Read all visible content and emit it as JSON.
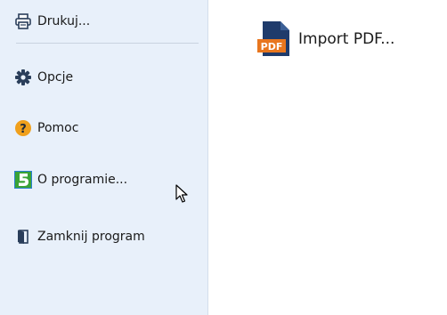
{
  "sidebar": {
    "items": [
      {
        "label": "Drukuj...",
        "icon": "printer-icon"
      },
      {
        "label": "Opcje",
        "icon": "gear-icon"
      },
      {
        "label": "Pomoc",
        "icon": "help-icon"
      },
      {
        "label": "O programie...",
        "icon": "app-logo-icon"
      },
      {
        "label": "Zamknij program",
        "icon": "exit-icon"
      }
    ]
  },
  "main": {
    "import_pdf": {
      "label": "Import PDF...",
      "icon": "pdf-icon"
    }
  },
  "colors": {
    "sidebar_bg": "#e8f0fa",
    "pdf_orange": "#e8761e",
    "pdf_navy": "#1f3b6b",
    "help_orange": "#f0a01c",
    "logo_green": "#3aa336",
    "logo_blue": "#2a7fd0",
    "icon_navy": "#2a3e5a"
  }
}
